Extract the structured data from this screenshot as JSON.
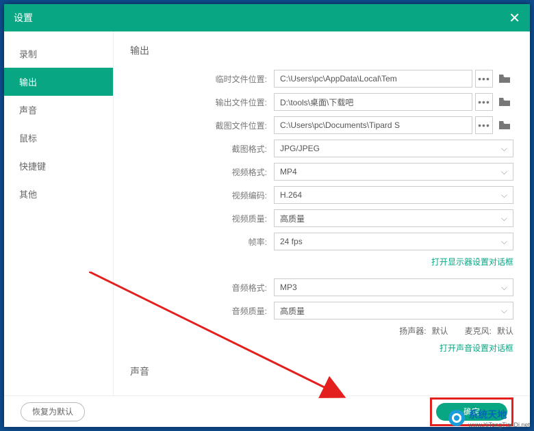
{
  "titlebar": {
    "title": "设置"
  },
  "sidebar": {
    "items": [
      {
        "label": "录制"
      },
      {
        "label": "输出"
      },
      {
        "label": "声音"
      },
      {
        "label": "鼠标"
      },
      {
        "label": "快捷键"
      },
      {
        "label": "其他"
      }
    ],
    "activeIndex": 1
  },
  "output": {
    "section_title": "输出",
    "tempPath": {
      "label": "临时文件位置:",
      "value": "C:\\Users\\pc\\AppData\\Local\\Tem"
    },
    "outPath": {
      "label": "输出文件位置:",
      "value": "D:\\tools\\桌面\\下载吧"
    },
    "shotPath": {
      "label": "截图文件位置:",
      "value": "C:\\Users\\pc\\Documents\\Tipard S"
    },
    "shotFmt": {
      "label": "截图格式:",
      "value": "JPG/JPEG"
    },
    "videoFmt": {
      "label": "视频格式:",
      "value": "MP4"
    },
    "videoEnc": {
      "label": "视频编码:",
      "value": "H.264"
    },
    "videoQ": {
      "label": "视频质量:",
      "value": "高质量"
    },
    "fps": {
      "label": "帧率:",
      "value": "24 fps"
    },
    "displayLink": "打开显示器设置对话框",
    "audioFmt": {
      "label": "音频格式:",
      "value": "MP3"
    },
    "audioQ": {
      "label": "音频质量:",
      "value": "高质量"
    },
    "speakerLabel": "扬声器:",
    "speakerValue": "默认",
    "micLabel": "麦克风:",
    "micValue": "默认",
    "audioLink": "打开声音设置对话框",
    "sound_section_title": "声音"
  },
  "footer": {
    "restore": "恢复为默认",
    "ok": "确定"
  },
  "watermark": {
    "name": "系统天地",
    "url": "www.XiTongTianDi.net"
  }
}
